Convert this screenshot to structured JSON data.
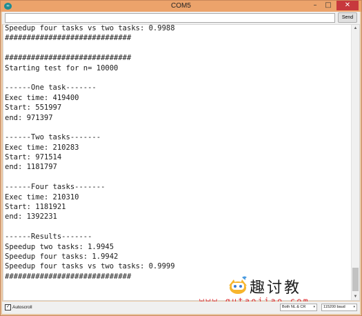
{
  "window": {
    "title": "COM5",
    "app_icon": "arduino-icon",
    "app_icon_glyph": "∞",
    "controls": {
      "minimize": "–",
      "maximize": "□",
      "close": "✕"
    },
    "close_color": "#c7383d",
    "titlebar_color": "#eca36b"
  },
  "input_row": {
    "value": "",
    "send_label": "Send"
  },
  "serial_lines": [
    "Speedup four tasks vs two tasks: 0.9988",
    "#############################",
    "",
    "#############################",
    "Starting test for n= 10000",
    "",
    "------One task-------",
    "Exec time: 419400",
    "Start: 551997",
    "end: 971397",
    "",
    "------Two tasks-------",
    "Exec time: 210283",
    "Start: 971514",
    "end: 1181797",
    "",
    "------Four tasks-------",
    "Exec time: 210310",
    "Start: 1181921",
    "end: 1392231",
    "",
    "------Results-------",
    "Speedup two tasks: 1.9945",
    "Speedup four tasks: 1.9942",
    "Speedup four tasks vs two tasks: 0.9999",
    "#############################"
  ],
  "watermark": {
    "text": "趣讨教",
    "url": "www.qutaojiao.com"
  },
  "bottom_bar": {
    "autoscroll_label": "Autoscroll",
    "autoscroll_checked": true,
    "check_glyph": "✓",
    "line_ending_value": "Both NL & CR",
    "baud_value": "115200 baud",
    "dropdown_glyph": "▾"
  },
  "scrollbar": {
    "up_glyph": "▲",
    "down_glyph": "▼"
  }
}
